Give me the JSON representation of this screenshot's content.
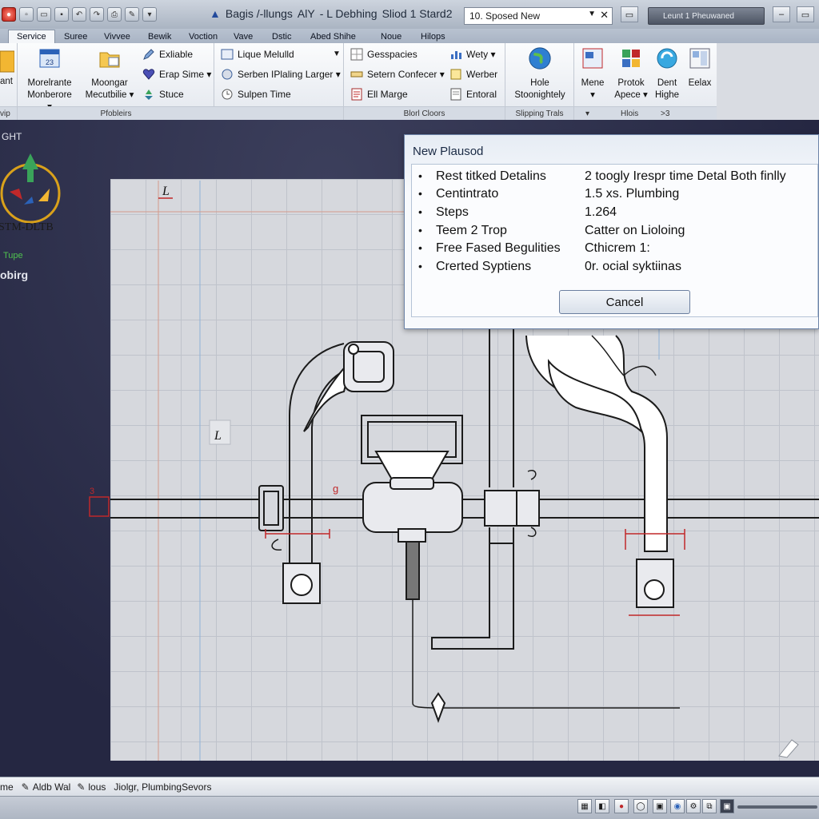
{
  "app": {
    "title_parts": [
      "Bagis /-llungs",
      "AlY",
      "- L Debhing",
      "Sliod 1 Stard2"
    ],
    "document_combo": "10. Sposed New",
    "search_box": "Leunt 1 Pheuwaned"
  },
  "tabs": [
    "Service",
    "Suree",
    "Vivvee",
    "Bewik",
    "Voction",
    "Vave",
    "Dstic",
    "Abed Shihe",
    "Noue",
    "Hilops"
  ],
  "active_tab": "Service",
  "ribbon": {
    "left_cut": {
      "line1": "ant",
      "line2": "vip"
    },
    "panel1": {
      "big1": {
        "line1": "Morelrante",
        "line2": "Monberore ▾"
      },
      "big2": {
        "line1": "Moongar",
        "line2": "Mecutbilie ▾"
      },
      "label": "Pfobleirs"
    },
    "panel1_small": [
      "Exliable",
      "Erap Sime ▾",
      "Stuce"
    ],
    "panel2_small": [
      "Lique Melulld",
      "Serben IPlaling Larger ▾",
      "Sulpen Time"
    ],
    "panel3_small": [
      "Gesspacies",
      "Setern Confecer ▾",
      "Ell Marge"
    ],
    "panel3b_small": [
      "Wety ▾",
      "Werber",
      "Entoral"
    ],
    "panel3_label": "Blorl Cloors",
    "panel4": {
      "big": {
        "line1": "Hole",
        "line2": "Stoonightely"
      },
      "label": "Slipping Trals"
    },
    "panel5": {
      "big1": {
        "line1": "Mene",
        "line2": "▾"
      },
      "big2": {
        "line1": "Protok",
        "line2": "Apece ▾"
      },
      "big3": {
        "line1": "Dent",
        "line2": "Highe"
      },
      "big4": {
        "line1": "Eelax",
        "line2": ""
      },
      "label_a": "Hlois",
      "label_b": ">3"
    }
  },
  "left_panel": {
    "t1": "GHT",
    "t2": "Tupe",
    "t3": "obirg",
    "logo_text": "STM-DLTB"
  },
  "drawing": {
    "marker1": "L",
    "marker2": "L",
    "marker3": "g",
    "marker4": "3"
  },
  "dialog": {
    "title": "New Plausod",
    "rows": [
      {
        "key": "Rest titked Detalins",
        "value": "2 toogly Irespr time Detal Both finlly"
      },
      {
        "key": "Centintrato",
        "value": "1.5 xs. Plumbing"
      },
      {
        "key": "Steps",
        "value": "1.264"
      },
      {
        "key": "Teem 2 Trop",
        "value": "Catter on Lioloing"
      },
      {
        "key": "Free Fased Begulities",
        "value": "Cthicrem 1:"
      },
      {
        "key": "Crerted Syptiens",
        "value": "0r. ocial syktiinas"
      }
    ],
    "cancel_label": "Cancel"
  },
  "statusbar": {
    "cut": "me",
    "item1": "Aldb Wal",
    "item2": "lous",
    "item3": "Jiolgr, PlumbingSevors"
  },
  "colors": {
    "accent": "#2b62b8",
    "dialog_border": "#6d84a8",
    "canvas_bg": "#2b2d48",
    "dimension_red": "#c0282a"
  }
}
